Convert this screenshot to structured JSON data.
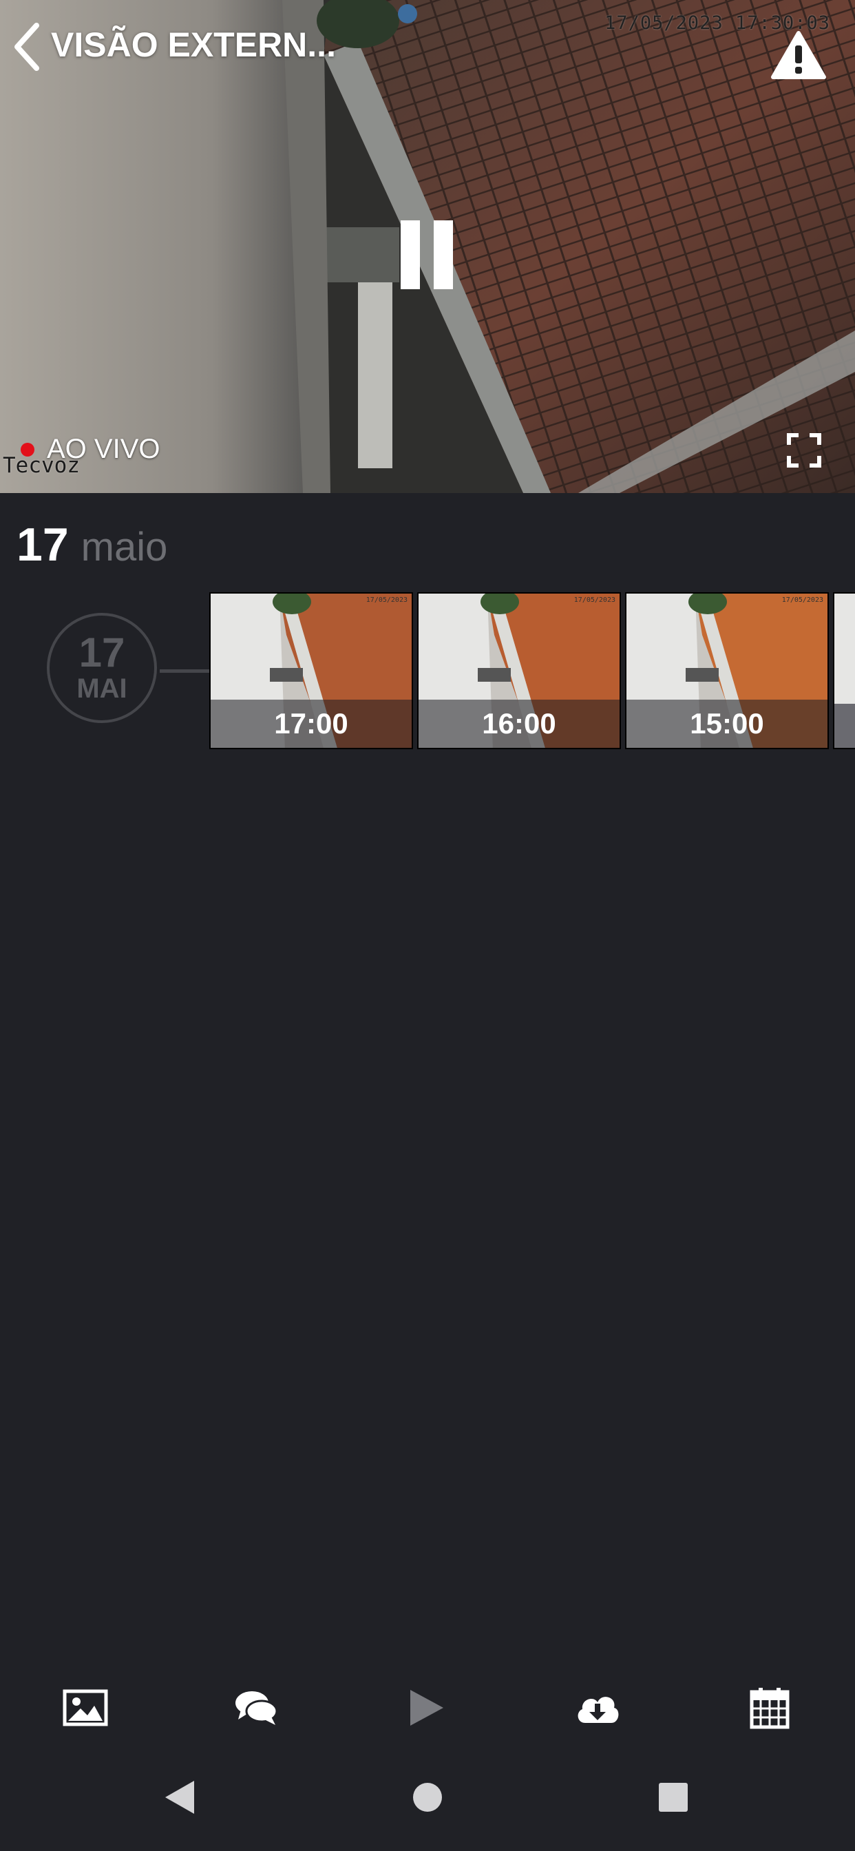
{
  "header": {
    "title": "VISÃO EXTERN...",
    "back_icon": "chevron-left-icon",
    "alert_icon": "warning-triangle-icon"
  },
  "video": {
    "camera_timestamp": "17/05/2023  17:30:03",
    "camera_brand": "Tecvoz",
    "live_label": "AO VIVO",
    "live_color": "#e3101a",
    "pause_icon": "pause-icon",
    "fullscreen_icon": "fullscreen-icon"
  },
  "timeline": {
    "date_day": "17",
    "date_month": "maio",
    "circle_day": "17",
    "circle_month": "MAI",
    "recordings": [
      {
        "time": "17:00",
        "stamp": "17/05/2023"
      },
      {
        "time": "16:00",
        "stamp": "17/05/2023"
      },
      {
        "time": "15:00",
        "stamp": "17/05/2023"
      }
    ]
  },
  "toolbar": {
    "items": [
      "gallery-icon",
      "chat-icon",
      "play-icon",
      "cloud-download-icon",
      "calendar-icon"
    ]
  },
  "colors": {
    "background": "#202126",
    "muted_text": "#6d6e73",
    "timeline_line": "#45464b"
  }
}
